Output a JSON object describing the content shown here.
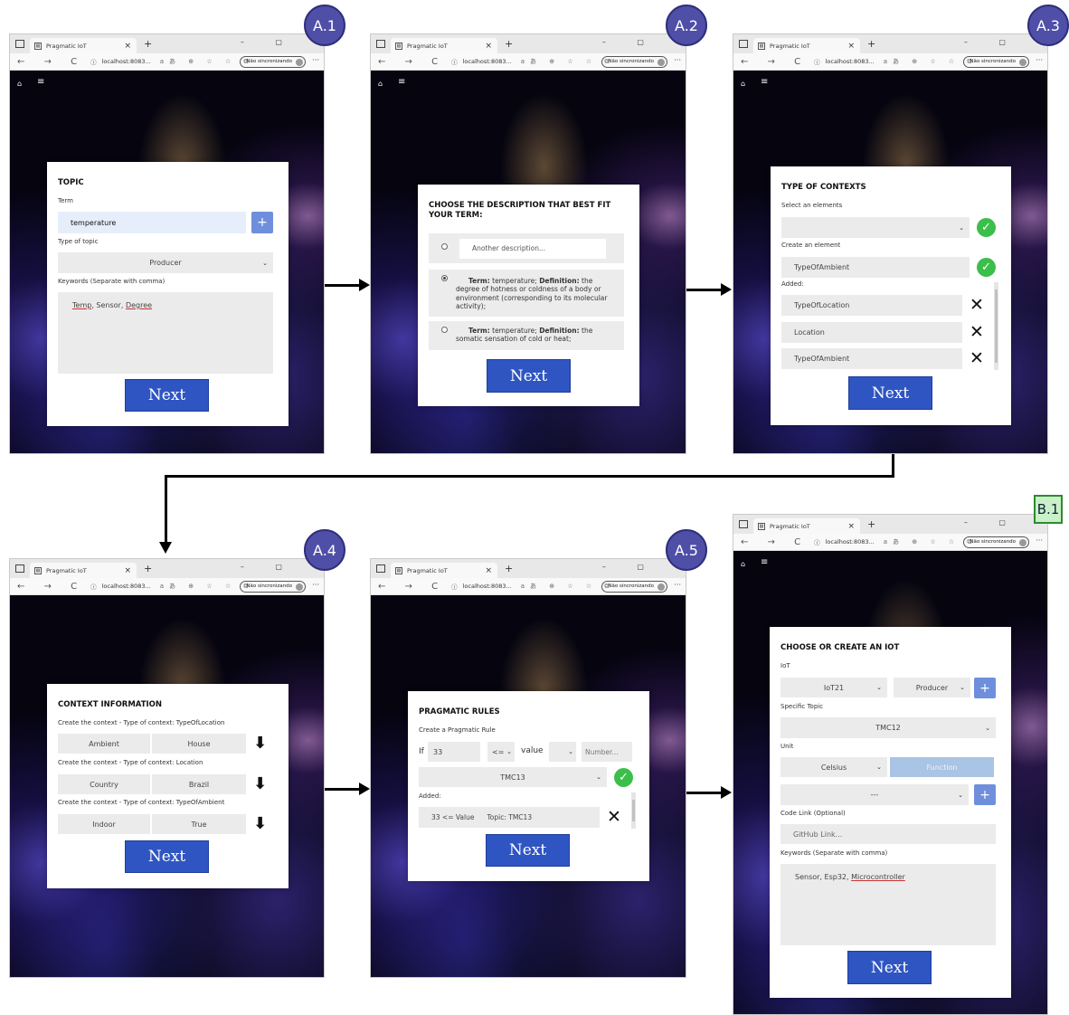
{
  "browser": {
    "tab_title": "Pragmatic IoT",
    "tab_close": "×",
    "new_tab": "+",
    "window_controls": "– ▢",
    "url": "localhost:8083...",
    "sync_label": "Não sincronizando",
    "more": "···",
    "nav_glyphs": "← → C",
    "info_glyph": "ⓘ",
    "tool_glyphs": "aあ ⊕ ☆ ☆ ⧉"
  },
  "badges": {
    "a1": "A.1",
    "a2": "A.2",
    "a3": "A.3",
    "a4": "A.4",
    "a5": "A.5",
    "b1": "B.1"
  },
  "common": {
    "next": "Next",
    "plus": "+",
    "check": "✓",
    "x": "✕",
    "down_arrow": "⬇",
    "chevron": "⌄",
    "home": "⌂",
    "menu": "≡"
  },
  "a1": {
    "title": "TOPIC",
    "term_label": "Term",
    "term_value": "temperature",
    "type_label": "Type of topic",
    "type_value": "Producer",
    "keywords_label": "Keywords (Separate with comma)",
    "kw1": "Temp",
    "kw2": "Sensor",
    "kw3": "Degree",
    "kw_sep": ", "
  },
  "a2": {
    "title_line1": "CHOOSE THE DESCRIPTION THAT BEST FIT",
    "title_line2": "YOUR TERM:",
    "other_placeholder": "Another description...",
    "opt1_term_label": "Term:",
    "opt1_term": "temperature;",
    "opt1_def_label": "Definition:",
    "opt1_def": "the degree of hotness or coldness of a body or environment (corresponding to its molecular activity);",
    "opt2_term_label": "Term:",
    "opt2_term": "temperature;",
    "opt2_def_label": "Definition:",
    "opt2_def": "the somatic sensation of cold or heat;"
  },
  "a3": {
    "title": "TYPE OF CONTEXTS",
    "select_label": "Select an elements",
    "create_label": "Create an element",
    "create_value": "TypeOfAmbient",
    "added_label": "Added:",
    "added": [
      "TypeOfLocation",
      "Location",
      "TypeOfAmbient"
    ]
  },
  "a4": {
    "title": "CONTEXT INFORMATION",
    "rows": [
      {
        "label": "Create the context - Type of context: TypeOfLocation",
        "left": "Ambient",
        "right": "House"
      },
      {
        "label": "Create the context - Type of context: Location",
        "left": "Country",
        "right": "Brazil"
      },
      {
        "label": "Create the context - Type of context: TypeOfAmbient",
        "left": "Indoor",
        "right": "True"
      }
    ]
  },
  "a5": {
    "title": "PRAGMATIC RULES",
    "create_label": "Create a Pragmatic Rule",
    "if_label": "If",
    "if_value": "33",
    "op_value": "<=",
    "value_label": "value",
    "number_placeholder": "Number...",
    "topic_value": "TMC13",
    "added_label": "Added:",
    "added_rule": "33 <= Value",
    "added_topic": "Topic: TMC13"
  },
  "b1": {
    "title": "CHOOSE OR CREATE AN IOT",
    "iot_label": "IoT",
    "iot_value": "IoT21",
    "iot_type": "Producer",
    "specific_label": "Specific Topic",
    "specific_value": "TMC12",
    "unit_label": "Unit",
    "unit_value": "Celsius",
    "function_label": "Function",
    "dash_value": "---",
    "code_label": "Code Link (Optional)",
    "code_placeholder": "GitHub Link...",
    "keywords_label": "Keywords (Separate with comma)",
    "kw1": "Sensor",
    "kw2": "Esp32",
    "kw3": "Microcontroller",
    "kw_sep": ", "
  }
}
